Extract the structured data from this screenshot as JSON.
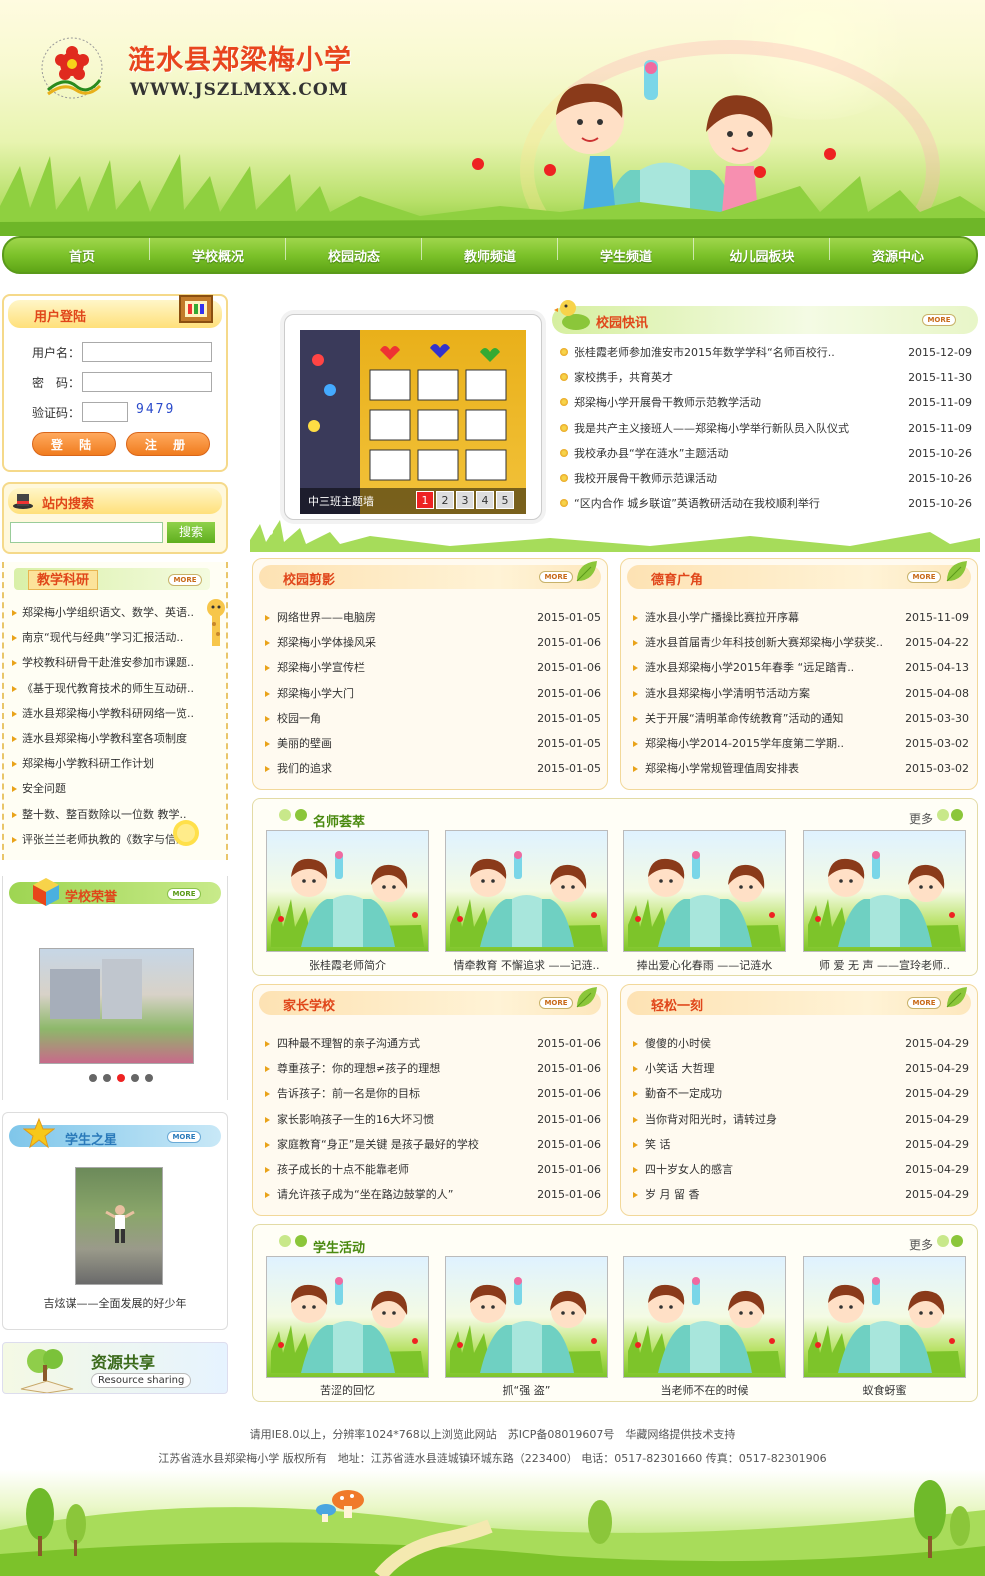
{
  "site": {
    "title": "涟水县郑梁梅小学",
    "url": "WWW.JSZLMXX.COM",
    "emblem_text": "ZHENGLIANGMEI SCHOOL"
  },
  "nav": [
    "首页",
    "学校概况",
    "校园动态",
    "教师频道",
    "学生频道",
    "幼儿园板块",
    "资源中心"
  ],
  "login": {
    "title": "用户登陆",
    "username_label": "用户名：",
    "password_label": "密　码：",
    "captcha_label": "验证码：",
    "captcha_code": "9479",
    "login_button": "登 陆",
    "register_button": "注 册"
  },
  "search": {
    "title": "站内搜索",
    "button": "搜索"
  },
  "more_label": "MORE",
  "research": {
    "title": "教学科研",
    "items": [
      "郑梁梅小学组织语文、数学、英语..",
      "南京“现代与经典”学习汇报活动..",
      "学校教科研骨干赴淮安参加市课题..",
      "《基于现代教育技术的师生互动研..",
      "涟水县郑梁梅小学教科研网络一览..",
      "涟水县郑梁梅小学教科室各项制度",
      "郑梁梅小学教科研工作计划",
      "安全问题",
      "整十数、整百数除以一位数 教学..",
      "评张兰兰老师执教的《数字与信息.."
    ]
  },
  "honors": {
    "title": "学校荣誉"
  },
  "stars": {
    "title": "学生之星",
    "caption": "吉炫谋——全面发展的好少年"
  },
  "resource": {
    "title": "资源共享",
    "subtitle": "Resource sharing"
  },
  "slideshow": {
    "caption": "中三班主题墙",
    "pages": [
      "1",
      "2",
      "3",
      "4",
      "5"
    ],
    "active": "1"
  },
  "news": {
    "title": "校园快讯",
    "items": [
      {
        "t": "张桂霞老师参加淮安市2015年数学学科“名师百校行..",
        "d": "2015-12-09"
      },
      {
        "t": "家校携手，共育英才",
        "d": "2015-11-30"
      },
      {
        "t": "郑梁梅小学开展骨干教师示范教学活动",
        "d": "2015-11-09"
      },
      {
        "t": "我是共产主义接班人——郑梁梅小学举行新队员入队仪式",
        "d": "2015-11-09"
      },
      {
        "t": "我校承办县“学在涟水”主题活动",
        "d": "2015-10-26"
      },
      {
        "t": "我校开展骨干教师示范课活动",
        "d": "2015-10-26"
      },
      {
        "t": "“区内合作 城乡联谊”英语教研活动在我校顺利举行",
        "d": "2015-10-26"
      }
    ]
  },
  "campus": {
    "title": "校园剪影",
    "items": [
      {
        "t": "网络世界——电脑房",
        "d": "2015-01-05"
      },
      {
        "t": "郑梁梅小学体操风采",
        "d": "2015-01-06"
      },
      {
        "t": "郑梁梅小学宣传栏",
        "d": "2015-01-06"
      },
      {
        "t": "郑梁梅小学大门",
        "d": "2015-01-06"
      },
      {
        "t": "校园一角",
        "d": "2015-01-05"
      },
      {
        "t": "美丽的壁画",
        "d": "2015-01-05"
      },
      {
        "t": "我们的追求",
        "d": "2015-01-05"
      }
    ]
  },
  "moral": {
    "title": "德育广角",
    "items": [
      {
        "t": "涟水县小学广播操比赛拉开序幕",
        "d": "2015-11-09"
      },
      {
        "t": "涟水县首届青少年科技创新大赛郑梁梅小学获奖..",
        "d": "2015-04-22"
      },
      {
        "t": "涟水县郑梁梅小学2015年春季 “远足踏青..",
        "d": "2015-04-13"
      },
      {
        "t": "涟水县郑梁梅小学清明节活动方案",
        "d": "2015-04-08"
      },
      {
        "t": "关于开展“清明革命传统教育”活动的通知",
        "d": "2015-03-30"
      },
      {
        "t": "郑梁梅小学2014-2015学年度第二学期..",
        "d": "2015-03-02"
      },
      {
        "t": "郑梁梅小学常规管理值周安排表",
        "d": "2015-03-02"
      }
    ]
  },
  "teachers": {
    "title": "名师荟萃",
    "more": "更多",
    "items": [
      "张桂霞老师简介",
      "情牵教育 不懈追求 ——记涟..",
      "捧出爱心化春雨 ——记涟水",
      "师 爱 无 声 ——宣玲老师.."
    ]
  },
  "parents": {
    "title": "家长学校",
    "items": [
      {
        "t": "四种最不理智的亲子沟通方式",
        "d": "2015-01-06"
      },
      {
        "t": "尊重孩子：你的理想≠孩子的理想",
        "d": "2015-01-06"
      },
      {
        "t": "告诉孩子：前一名是你的目标",
        "d": "2015-01-06"
      },
      {
        "t": "家长影响孩子一生的16大坏习惯",
        "d": "2015-01-06"
      },
      {
        "t": "家庭教育“身正”是关键 是孩子最好的学校",
        "d": "2015-01-06"
      },
      {
        "t": "孩子成长的十点不能靠老师",
        "d": "2015-01-06"
      },
      {
        "t": "请允许孩子成为“坐在路边鼓掌的人”",
        "d": "2015-01-06"
      }
    ]
  },
  "relax": {
    "title": "轻松一刻",
    "items": [
      {
        "t": "傻傻的小时侯",
        "d": "2015-04-29"
      },
      {
        "t": "小笑话 大哲理",
        "d": "2015-04-29"
      },
      {
        "t": "勤奋不一定成功",
        "d": "2015-04-29"
      },
      {
        "t": "当你背对阳光时，请转过身",
        "d": "2015-04-29"
      },
      {
        "t": "笑 话",
        "d": "2015-04-29"
      },
      {
        "t": "四十岁女人的感言",
        "d": "2015-04-29"
      },
      {
        "t": "岁 月 留 香",
        "d": "2015-04-29"
      }
    ]
  },
  "activities": {
    "title": "学生活动",
    "more": "更多",
    "items": [
      "苦涩的回忆",
      "抓“强 盗”",
      "当老师不在的时候",
      "蚁食蚜蜜"
    ]
  },
  "footer": {
    "line1": "请用IE8.0以上，分辨率1024*768以上浏览此网站　苏ICP备08019607号　华藏网络提供技术支持",
    "line2": "江苏省涟水县郑梁梅小学 版权所有　地址：江苏省涟水县涟城镇环城东路（223400） 电话：0517-82301660 传真：0517-82301906"
  },
  "colors": {
    "nav_green": "#7cc22a",
    "title_red": "#e0461a",
    "accent_orange": "#f07c1e"
  }
}
